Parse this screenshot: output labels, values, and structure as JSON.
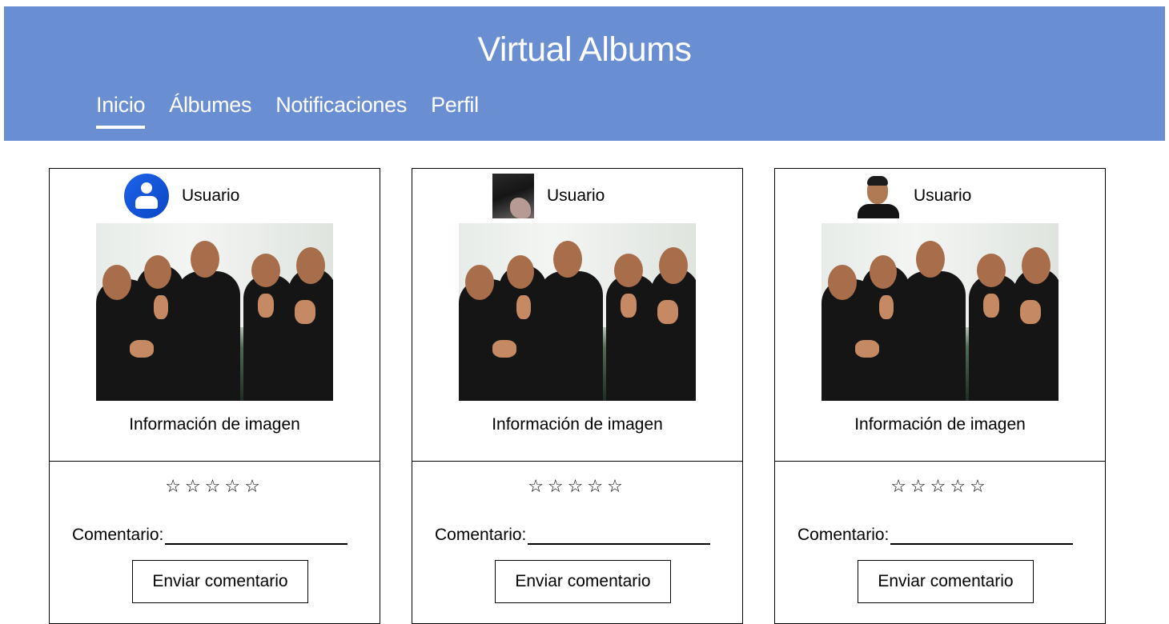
{
  "header": {
    "title": "Virtual Albums",
    "background_color": "#6a8ed2",
    "nav": [
      {
        "label": "Inicio",
        "active": true
      },
      {
        "label": "Álbumes",
        "active": false
      },
      {
        "label": "Notificaciones",
        "active": false
      },
      {
        "label": "Perfil",
        "active": false
      }
    ]
  },
  "posts": [
    {
      "user_name": "Usuario",
      "avatar": "default-user-icon",
      "image_info": "Información de imagen",
      "stars": "☆☆☆☆☆",
      "rating": 0,
      "comment_label": "Comentario:",
      "comment_value": "",
      "send_label": "Enviar comentario"
    },
    {
      "user_name": "Usuario",
      "avatar": "photo-avatar",
      "image_info": "Información de imagen",
      "stars": "☆☆☆☆☆",
      "rating": 0,
      "comment_label": "Comentario:",
      "comment_value": "",
      "send_label": "Enviar comentario"
    },
    {
      "user_name": "Usuario",
      "avatar": "photo-avatar",
      "image_info": "Información de imagen",
      "stars": "☆☆☆☆☆",
      "rating": 0,
      "comment_label": "Comentario:",
      "comment_value": "",
      "send_label": "Enviar comentario"
    }
  ]
}
